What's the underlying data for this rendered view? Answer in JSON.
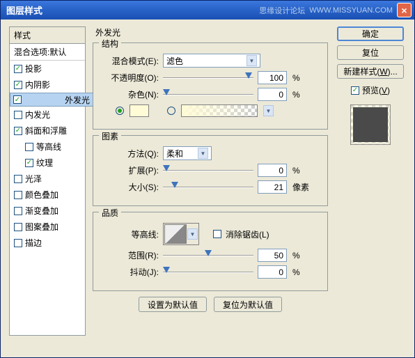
{
  "titlebar": {
    "title": "图层样式",
    "site": "思缘设计论坛",
    "url": "WWW.MISSYUAN.COM"
  },
  "left": {
    "header": "样式",
    "blend": "混合选项:默认",
    "items": [
      {
        "label": "投影",
        "check": true
      },
      {
        "label": "内阴影",
        "check": true
      },
      {
        "label": "外发光",
        "check": true,
        "selected": true
      },
      {
        "label": "内发光",
        "check": false
      },
      {
        "label": "斜面和浮雕",
        "check": true
      },
      {
        "label": "等高线",
        "check": false,
        "sub": true
      },
      {
        "label": "纹理",
        "check": true,
        "sub": true
      },
      {
        "label": "光泽",
        "check": false
      },
      {
        "label": "颜色叠加",
        "check": false
      },
      {
        "label": "渐变叠加",
        "check": false
      },
      {
        "label": "图案叠加",
        "check": false
      },
      {
        "label": "描边",
        "check": false
      }
    ]
  },
  "main": {
    "title": "外发光",
    "struct": {
      "legend": "结构",
      "blend_lbl": "混合模式(E):",
      "blend_val": "滤色",
      "opacity_lbl": "不透明度(O):",
      "opacity": "100",
      "noise_lbl": "杂色(N):",
      "noise": "0"
    },
    "elem": {
      "legend": "图素",
      "method_lbl": "方法(Q):",
      "method_val": "柔和",
      "spread_lbl": "扩展(P):",
      "spread": "0",
      "size_lbl": "大小(S):",
      "size": "21",
      "px": "像素"
    },
    "qual": {
      "legend": "品质",
      "contour_lbl": "等高线:",
      "aa": "消除锯齿(L)",
      "range_lbl": "范围(R):",
      "range": "50",
      "jitter_lbl": "抖动(J):",
      "jitter": "0"
    },
    "btn_default": "设置为默认值",
    "btn_reset": "复位为默认值",
    "pct": "%"
  },
  "right": {
    "ok": "确定",
    "cancel": "复位",
    "newstyle": "新建样式(W)...",
    "preview": "预览(V)"
  }
}
